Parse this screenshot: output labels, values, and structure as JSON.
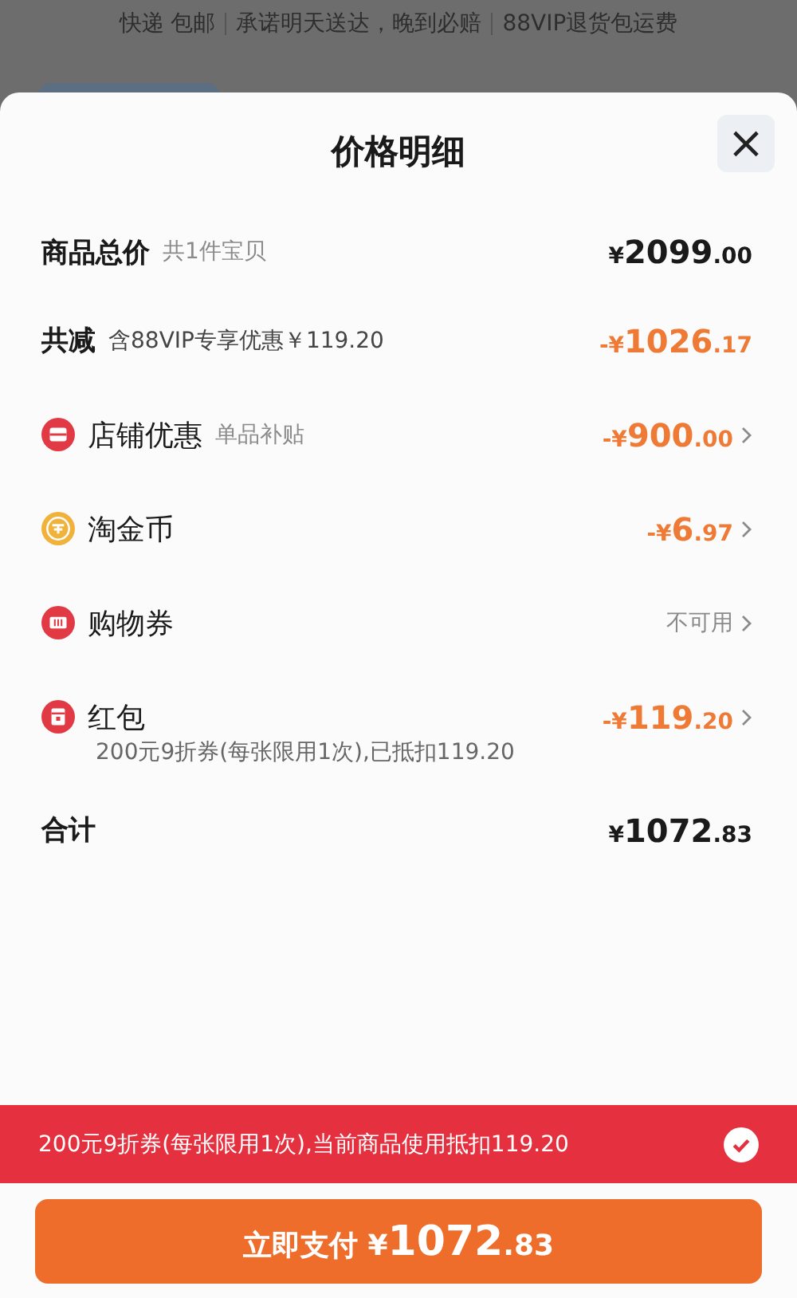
{
  "background": {
    "notices": [
      "快递 包邮",
      "承诺明天送达，晚到必赔",
      "88VIP退货包运费"
    ]
  },
  "sheet": {
    "title": "价格明细",
    "close": "×",
    "rows": [
      {
        "kind": "heading",
        "label": "商品总价",
        "note": "共1件宝贝",
        "color": "#1a1a1a",
        "price": {
          "prefix": "¥",
          "main": "2099",
          "fraction": ".00"
        }
      },
      {
        "kind": "heading",
        "label": "共减",
        "note": "含88VIP专享优惠￥119.20",
        "color": "#ee7a36",
        "price": {
          "prefix": "-¥",
          "main": "1026",
          "fraction": ".17"
        }
      },
      {
        "kind": "shop",
        "label": "店铺优惠",
        "note": "单品补贴",
        "color": "#ee7a36",
        "price": {
          "prefix": "-¥",
          "main": "900",
          "fraction": ".00"
        }
      },
      {
        "kind": "coin",
        "label": "淘金币",
        "color": "#ee7a36",
        "price": {
          "prefix": "-¥",
          "main": "6",
          "fraction": ".97"
        }
      },
      {
        "kind": "ticket",
        "label": "购物券",
        "color": "#8a8a8a",
        "status": "不可用"
      },
      {
        "kind": "packet",
        "label": "红包",
        "color": "#ee7a36",
        "price": {
          "prefix": "-¥",
          "main": "119",
          "fraction": ".20"
        },
        "detail": "200元9折券(每张限用1次),已抵扣119.20"
      },
      {
        "kind": "heading",
        "label": "合计",
        "color": "#1a1a1a",
        "price": {
          "prefix": "¥",
          "main": "1072",
          "fraction": ".83"
        }
      }
    ]
  },
  "coupon_banner": {
    "text": "200元9折券(每张限用1次),当前商品使用抵扣119.20",
    "checked": true
  },
  "pay_button": {
    "label": "立即支付",
    "price": {
      "prefix": "¥",
      "main": "1072",
      "fraction": ".83"
    }
  }
}
